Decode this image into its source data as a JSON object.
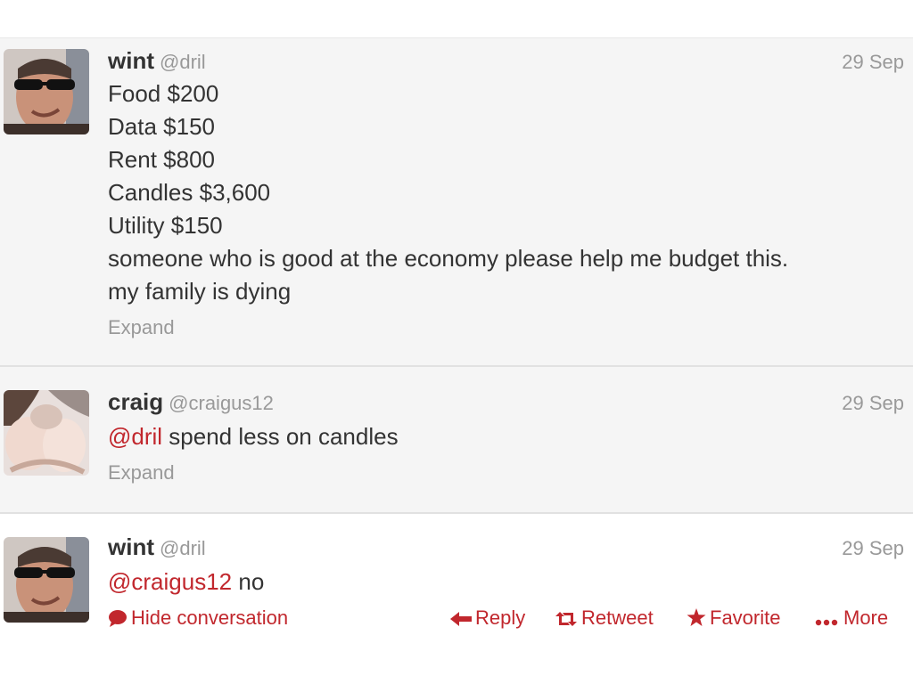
{
  "tweets": [
    {
      "name": "wint",
      "handle": "@dril",
      "time": "29 Sep",
      "lines": [
        "Food $200",
        "Data $150",
        "Rent $800",
        "Candles $3,600",
        "Utility $150",
        "someone who is good at the economy please help me budget this.",
        "my family is dying"
      ],
      "expand": "Expand"
    },
    {
      "name": "craig",
      "handle": "@craigus12",
      "time": "29 Sep",
      "mention": "@dril",
      "text": " spend less on candles",
      "expand": "Expand"
    },
    {
      "name": "wint",
      "handle": "@dril",
      "time": "29 Sep",
      "mention": "@craigus12",
      "text": " no",
      "actions": {
        "hide_conversation": "Hide conversation",
        "reply": "Reply",
        "retweet": "Retweet",
        "favorite": "Favorite",
        "more": "More"
      }
    }
  ],
  "colors": {
    "accent": "#c1272d",
    "muted": "#999999",
    "text": "#333333",
    "tweet_bg_expanded": "#f5f5f5"
  },
  "icons": {
    "hide_conversation": "speech-bubble-icon",
    "reply": "reply-arrow-icon",
    "retweet": "retweet-icon",
    "favorite": "star-icon",
    "more": "dots-icon"
  }
}
